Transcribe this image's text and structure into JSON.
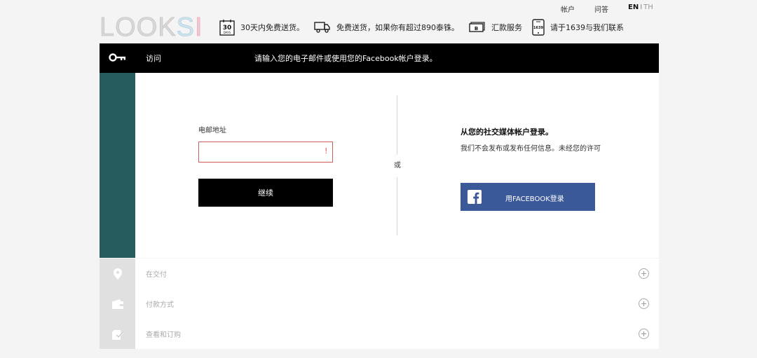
{
  "brand": {
    "logo_l": "LOOK",
    "logo_s": "S",
    "logo_i": "I"
  },
  "top_links": {
    "account": "帐户",
    "faq": "问答",
    "lang_en": "EN",
    "lang_sep": "I",
    "lang_th": "TH"
  },
  "benefits": {
    "returns_badge": "30",
    "returns_badge_sub": "DAYS",
    "returns": "30天内免费送货。",
    "shipping": "免费送货，如果你有超过890泰铢。",
    "payment_badge": "B",
    "payment": "汇款服务",
    "contact_badge": "1639",
    "contact": "请于1639与我们联系"
  },
  "login": {
    "bar_title": "访问",
    "bar_message": "请输入您的电子邮件或使用您的Facebook帐户登录。",
    "email_label": "电邮地址",
    "email_value": "",
    "warning": "!",
    "continue_label": "继续",
    "or_label": "或",
    "social_title": "从您的社交媒体帐户登录。",
    "social_note": "我们不会发布或发布任何信息。未经您的许可",
    "facebook_label": "用FACEBOOK登录"
  },
  "steps": [
    {
      "label": "在交付",
      "icon": "location-pin-icon"
    },
    {
      "label": "付款方式",
      "icon": "wallet-icon"
    },
    {
      "label": "查看和订购",
      "icon": "checkout-bag-icon"
    }
  ]
}
